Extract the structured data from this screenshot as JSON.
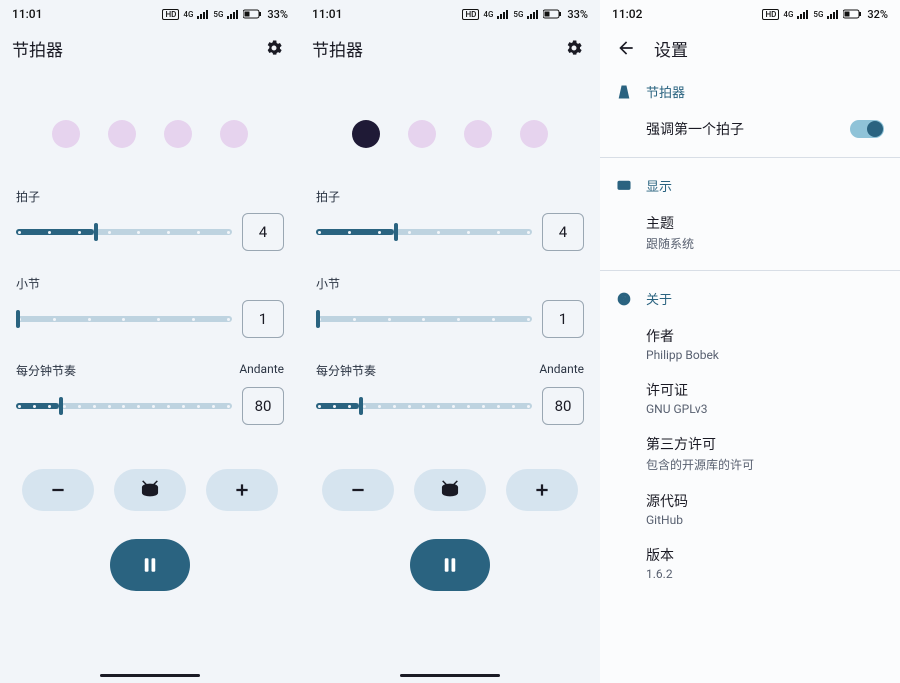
{
  "status": {
    "time1": "11:01",
    "time2": "11:01",
    "time3": "11:02",
    "battery1": "33%",
    "battery2": "33%",
    "battery3": "32%",
    "hd": "HD",
    "net4g": "4G",
    "net5g": "5G"
  },
  "app": {
    "title": "节拍器"
  },
  "screen1": {
    "active_beat": -1,
    "beats": {
      "label": "拍子",
      "value": "4",
      "fill_pct": 36
    },
    "bars": {
      "label": "小节",
      "value": "1",
      "fill_pct": 0
    },
    "bpm": {
      "label": "每分钟节奏",
      "tempo": "Andante",
      "value": "80",
      "fill_pct": 20
    }
  },
  "screen2": {
    "active_beat": 0,
    "beats": {
      "label": "拍子",
      "value": "4",
      "fill_pct": 36
    },
    "bars": {
      "label": "小节",
      "value": "1",
      "fill_pct": 0
    },
    "bpm": {
      "label": "每分钟节奏",
      "tempo": "Andante",
      "value": "80",
      "fill_pct": 20
    }
  },
  "settings": {
    "title": "设置",
    "section_metronome": "节拍器",
    "emphasize": "强调第一个拍子",
    "section_display": "显示",
    "theme_title": "主题",
    "theme_sub": "跟随系统",
    "section_about": "关于",
    "author_title": "作者",
    "author_sub": "Philipp Bobek",
    "license_title": "许可证",
    "license_sub": "GNU GPLv3",
    "third_title": "第三方许可",
    "third_sub": "包含的开源库的许可",
    "source_title": "源代码",
    "source_sub": "GitHub",
    "version_title": "版本",
    "version_sub": "1.6.2"
  }
}
